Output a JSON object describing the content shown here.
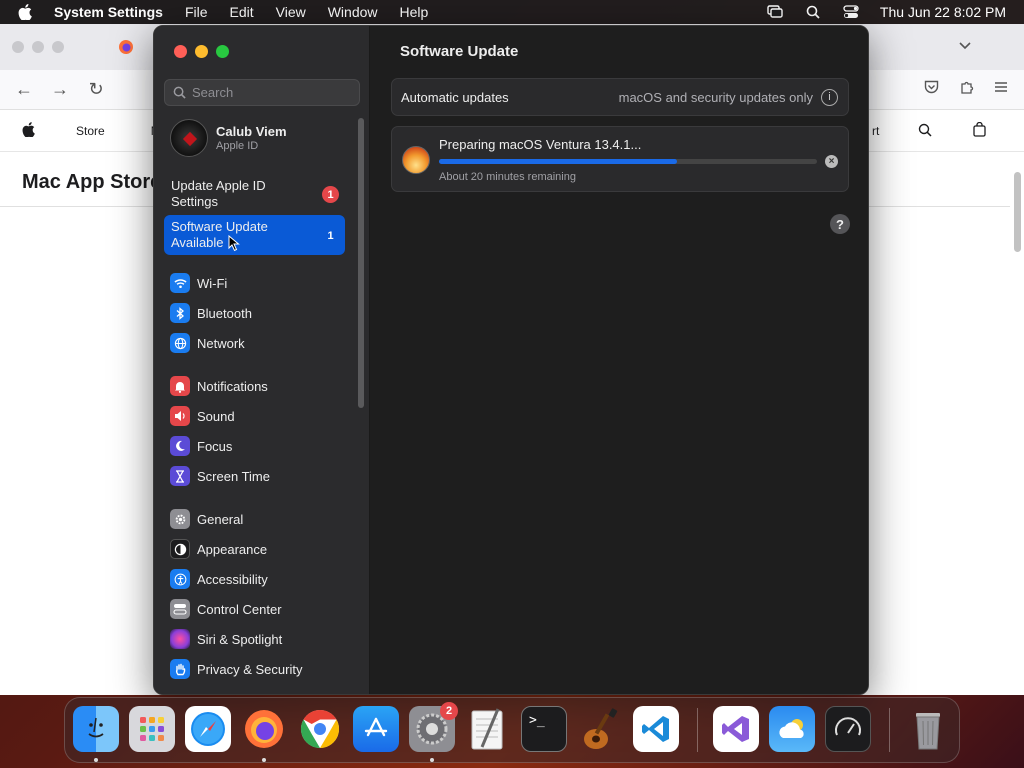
{
  "menubar": {
    "app_name": "System Settings",
    "items": [
      "File",
      "Edit",
      "View",
      "Window",
      "Help"
    ],
    "datetime": "Thu Jun 22  8:02 PM"
  },
  "browser": {
    "site_nav": {
      "store": "Store",
      "partial_m": "M",
      "partial_rt": "rt"
    },
    "page_title": "Mac App Store"
  },
  "sidebar": {
    "search_placeholder": "Search",
    "user": {
      "name": "Calub Viem",
      "subtitle": "Apple ID"
    },
    "alerts": [
      {
        "label": "Update Apple ID Settings",
        "badge": "1"
      },
      {
        "label": "Software Update Available",
        "badge": "1"
      }
    ],
    "groups": [
      [
        {
          "label": "Wi-Fi",
          "icon": "wifi-icon",
          "color": "#1a7cf0"
        },
        {
          "label": "Bluetooth",
          "icon": "bluetooth-icon",
          "color": "#1a7cf0"
        },
        {
          "label": "Network",
          "icon": "globe-icon",
          "color": "#1a7cf0"
        }
      ],
      [
        {
          "label": "Notifications",
          "icon": "bell-icon",
          "color": "#e5474a"
        },
        {
          "label": "Sound",
          "icon": "speaker-icon",
          "color": "#e5474a"
        },
        {
          "label": "Focus",
          "icon": "moon-icon",
          "color": "#5b4bd6"
        },
        {
          "label": "Screen Time",
          "icon": "hourglass-icon",
          "color": "#5b4bd6"
        }
      ],
      [
        {
          "label": "General",
          "icon": "gear-icon",
          "color": "#8e8e93"
        },
        {
          "label": "Appearance",
          "icon": "appearance-icon",
          "color": "#1c1c1e"
        },
        {
          "label": "Accessibility",
          "icon": "accessibility-icon",
          "color": "#1a7cf0"
        },
        {
          "label": "Control Center",
          "icon": "control-center-icon",
          "color": "#8e8e93"
        },
        {
          "label": "Siri & Spotlight",
          "icon": "siri-icon",
          "color": "#8a3ed8"
        },
        {
          "label": "Privacy & Security",
          "icon": "hand-icon",
          "color": "#1a7cf0"
        }
      ]
    ]
  },
  "main": {
    "title": "Software Update",
    "automatic_updates": {
      "label": "Automatic updates",
      "value": "macOS and security updates only"
    },
    "update": {
      "title": "Preparing macOS Ventura 13.4.1...",
      "subtitle": "About 20 minutes remaining",
      "progress": 0.63
    }
  },
  "dock": {
    "apps": [
      "Finder",
      "Launchpad",
      "Safari",
      "Firefox",
      "Chrome",
      "App Store",
      "System Settings",
      "TextEdit",
      "Terminal",
      "GarageBand",
      "Visual Studio Code",
      "Visual Studio",
      "Weather",
      "Activity Monitor",
      "Trash"
    ],
    "settings_badge": "2"
  }
}
